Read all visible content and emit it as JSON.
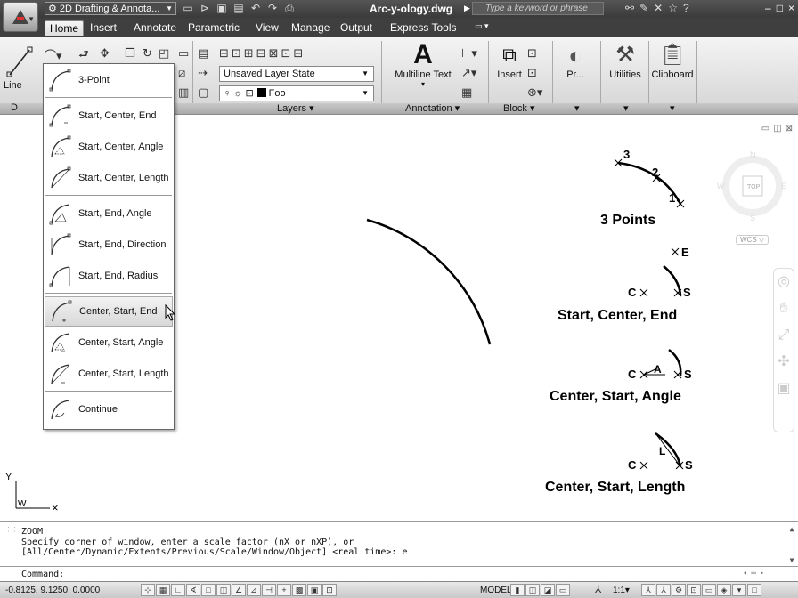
{
  "titlebar": {
    "workspace": "2D Drafting & Annota...",
    "document": "Arc-y-ology.dwg",
    "search_placeholder": "Type a keyword or phrase"
  },
  "tabs": [
    "Home",
    "Insert",
    "Annotate",
    "Parametric",
    "View",
    "Manage",
    "Output",
    "Express Tools"
  ],
  "ribbon": {
    "line_label": "Line",
    "draw_panel": "D",
    "layer_state": "Unsaved Layer State",
    "current_layer": "Foo",
    "layers_panel": "Layers ▾",
    "multiline_text": "Multiline Text",
    "annotation_panel": "Annotation ▾",
    "insert_label": "Insert",
    "block_panel": "Block ▾",
    "properties_label": "Pr...",
    "utilities_label": "Utilities",
    "clipboard_label": "Clipboard",
    "more_caret": "▾"
  },
  "arc_menu": {
    "items": [
      "3-Point",
      "Start, Center, End",
      "Start, Center, Angle",
      "Start, Center, Length",
      "Start, End, Angle",
      "Start, End, Direction",
      "Start, End, Radius",
      "Center, Start, End",
      "Center, Start, Angle",
      "Center, Start, Length",
      "Continue"
    ],
    "highlighted": "Center, Start, End"
  },
  "drawing": {
    "labels": {
      "p3": "3",
      "p2": "2",
      "p1": "1",
      "three_points": "3 Points",
      "e": "E",
      "c1": "C",
      "s1": "S",
      "start_center_end": "Start, Center, End",
      "c2": "C",
      "a": "A",
      "s2": "S",
      "center_start_angle": "Center, Start, Angle",
      "l": "L",
      "c3": "C",
      "s3": "S",
      "center_start_length": "Center, Start, Length"
    },
    "viewcube": {
      "n": "N",
      "s": "S",
      "e": "E",
      "w": "W",
      "top": "TOP",
      "wcs": "WCS ▽"
    },
    "ucs": {
      "y": "Y",
      "w": "W",
      "x": "×"
    }
  },
  "command": {
    "history": [
      "ZOOM",
      "Specify corner of window, enter a scale factor (nX or nXP), or",
      "[All/Center/Dynamic/Extents/Previous/Scale/Window/Object] <real time>: e"
    ],
    "prompt": "Command:"
  },
  "statusbar": {
    "coords": "-0.8125, 9.1250, 0.0000",
    "model": "MODEL",
    "scale": "1:1▾"
  }
}
